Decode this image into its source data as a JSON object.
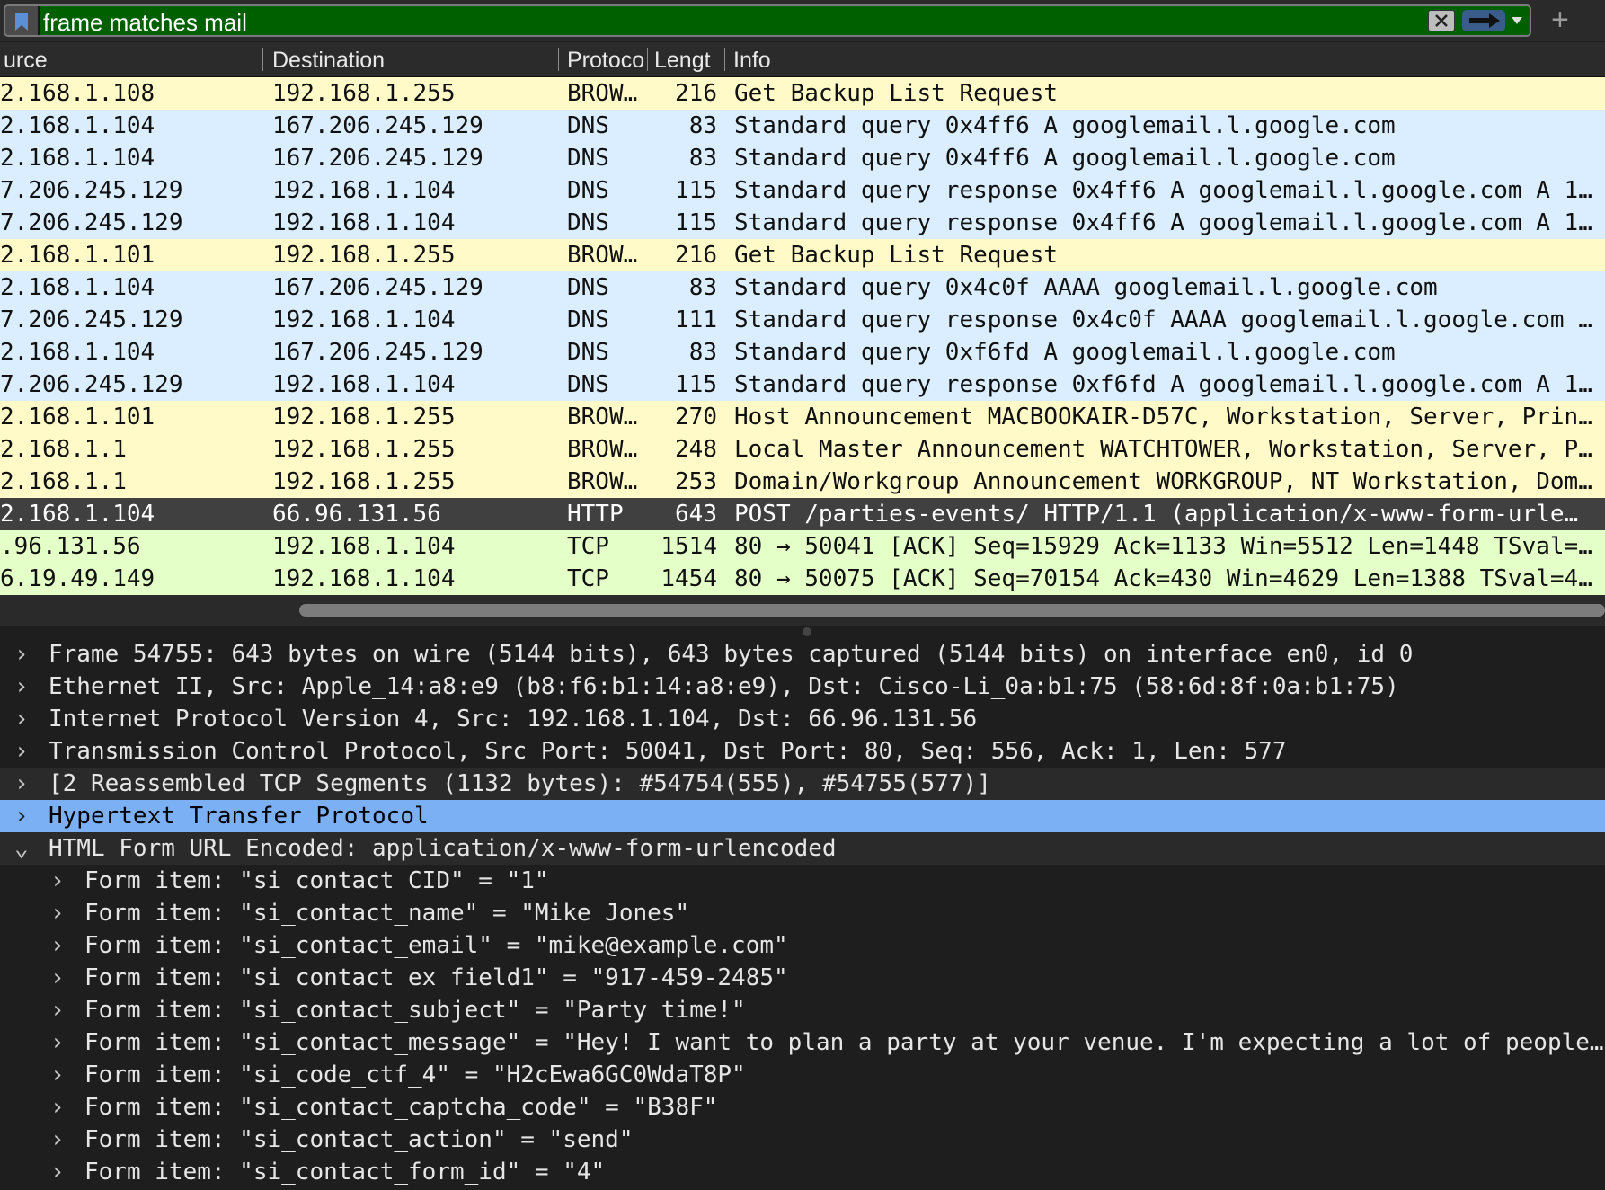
{
  "filter": {
    "expression": "frame matches mail",
    "color": "#006000"
  },
  "columns": [
    "urce",
    "Destination",
    "Protoco",
    "Lengt",
    "Info"
  ],
  "colors": {
    "browser": "#fffac8",
    "dns": "#daeeff",
    "tcp": "#e4ffc7",
    "selected": "#404040",
    "tree_selected": "#7cb0f4"
  },
  "packets": [
    {
      "src": "2.168.1.108",
      "dst": "192.168.1.255",
      "proto": "BROW…",
      "len": "216",
      "info": "Get Backup List Request",
      "color": "#fffac8"
    },
    {
      "src": "2.168.1.104",
      "dst": "167.206.245.129",
      "proto": "DNS",
      "len": "83",
      "info": "Standard query 0x4ff6 A googlemail.l.google.com",
      "color": "#daeeff"
    },
    {
      "src": "2.168.1.104",
      "dst": "167.206.245.129",
      "proto": "DNS",
      "len": "83",
      "info": "Standard query 0x4ff6 A googlemail.l.google.com",
      "color": "#daeeff"
    },
    {
      "src": "7.206.245.129",
      "dst": "192.168.1.104",
      "proto": "DNS",
      "len": "115",
      "info": "Standard query response 0x4ff6 A googlemail.l.google.com A 1…",
      "color": "#daeeff"
    },
    {
      "src": "7.206.245.129",
      "dst": "192.168.1.104",
      "proto": "DNS",
      "len": "115",
      "info": "Standard query response 0x4ff6 A googlemail.l.google.com A 1…",
      "color": "#daeeff"
    },
    {
      "src": "2.168.1.101",
      "dst": "192.168.1.255",
      "proto": "BROW…",
      "len": "216",
      "info": "Get Backup List Request",
      "color": "#fffac8"
    },
    {
      "src": "2.168.1.104",
      "dst": "167.206.245.129",
      "proto": "DNS",
      "len": "83",
      "info": "Standard query 0x4c0f AAAA googlemail.l.google.com",
      "color": "#daeeff"
    },
    {
      "src": "7.206.245.129",
      "dst": "192.168.1.104",
      "proto": "DNS",
      "len": "111",
      "info": "Standard query response 0x4c0f AAAA googlemail.l.google.com …",
      "color": "#daeeff"
    },
    {
      "src": "2.168.1.104",
      "dst": "167.206.245.129",
      "proto": "DNS",
      "len": "83",
      "info": "Standard query 0xf6fd A googlemail.l.google.com",
      "color": "#daeeff"
    },
    {
      "src": "7.206.245.129",
      "dst": "192.168.1.104",
      "proto": "DNS",
      "len": "115",
      "info": "Standard query response 0xf6fd A googlemail.l.google.com A 1…",
      "color": "#daeeff"
    },
    {
      "src": "2.168.1.101",
      "dst": "192.168.1.255",
      "proto": "BROW…",
      "len": "270",
      "info": "Host Announcement MACBOOKAIR-D57C, Workstation, Server, Prin…",
      "color": "#fffac8"
    },
    {
      "src": "2.168.1.1",
      "dst": "192.168.1.255",
      "proto": "BROW…",
      "len": "248",
      "info": "Local Master Announcement WATCHTOWER, Workstation, Server, P…",
      "color": "#fffac8"
    },
    {
      "src": "2.168.1.1",
      "dst": "192.168.1.255",
      "proto": "BROW…",
      "len": "253",
      "info": "Domain/Workgroup Announcement WORKGROUP, NT Workstation, Dom…",
      "color": "#fffac8"
    },
    {
      "src": "2.168.1.104",
      "dst": "66.96.131.56",
      "proto": "HTTP",
      "len": "643",
      "info": "POST /parties-events/ HTTP/1.1  (application/x-www-form-urle…",
      "color": "#404040",
      "selected": true
    },
    {
      "src": ".96.131.56",
      "dst": "192.168.1.104",
      "proto": "TCP",
      "len": "1514",
      "info": "80 → 50041 [ACK] Seq=15929 Ack=1133 Win=5512 Len=1448 TSval=…",
      "color": "#e4ffc7"
    },
    {
      "src": "6.19.49.149",
      "dst": "192.168.1.104",
      "proto": "TCP",
      "len": "1454",
      "info": "80 → 50075 [ACK] Seq=70154 Ack=430 Win=4629 Len=1388 TSval=4…",
      "color": "#e4ffc7"
    }
  ],
  "details": [
    {
      "level": 0,
      "expanded": false,
      "text": "Frame 54755: 643 bytes on wire (5144 bits), 643 bytes captured (5144 bits) on interface en0, id 0"
    },
    {
      "level": 0,
      "expanded": false,
      "text": "Ethernet II, Src: Apple_14:a8:e9 (b8:f6:b1:14:a8:e9), Dst: Cisco-Li_0a:b1:75 (58:6d:8f:0a:b1:75)"
    },
    {
      "level": 0,
      "expanded": false,
      "text": "Internet Protocol Version 4, Src: 192.168.1.104, Dst: 66.96.131.56"
    },
    {
      "level": 0,
      "expanded": false,
      "text": "Transmission Control Protocol, Src Port: 50041, Dst Port: 80, Seq: 556, Ack: 1, Len: 577"
    },
    {
      "level": 0,
      "expanded": false,
      "text": "[2 Reassembled TCP Segments (1132 bytes): #54754(555), #54755(577)]"
    },
    {
      "level": 0,
      "expanded": false,
      "selected": true,
      "text": "Hypertext Transfer Protocol"
    },
    {
      "level": 0,
      "expanded": true,
      "text": "HTML Form URL Encoded: application/x-www-form-urlencoded"
    },
    {
      "level": 1,
      "expanded": false,
      "text": "Form item: \"si_contact_CID\" = \"1\""
    },
    {
      "level": 1,
      "expanded": false,
      "text": "Form item: \"si_contact_name\" = \"Mike Jones\""
    },
    {
      "level": 1,
      "expanded": false,
      "text": "Form item: \"si_contact_email\" = \"mike@example.com\""
    },
    {
      "level": 1,
      "expanded": false,
      "text": "Form item: \"si_contact_ex_field1\" = \"917-459-2485\""
    },
    {
      "level": 1,
      "expanded": false,
      "text": "Form item: \"si_contact_subject\" = \"Party time!\""
    },
    {
      "level": 1,
      "expanded": false,
      "text": "Form item: \"si_contact_message\" = \"Hey! I want to plan a party at your venue. I'm expecting a lot of people…"
    },
    {
      "level": 1,
      "expanded": false,
      "text": "Form item: \"si_code_ctf_4\" = \"H2cEwa6GC0WdaT8P\""
    },
    {
      "level": 1,
      "expanded": false,
      "text": "Form item: \"si_contact_captcha_code\" = \"B38F\""
    },
    {
      "level": 1,
      "expanded": false,
      "text": "Form item: \"si_contact_action\" = \"send\""
    },
    {
      "level": 1,
      "expanded": false,
      "text": "Form item: \"si_contact_form_id\" = \"4\""
    }
  ]
}
